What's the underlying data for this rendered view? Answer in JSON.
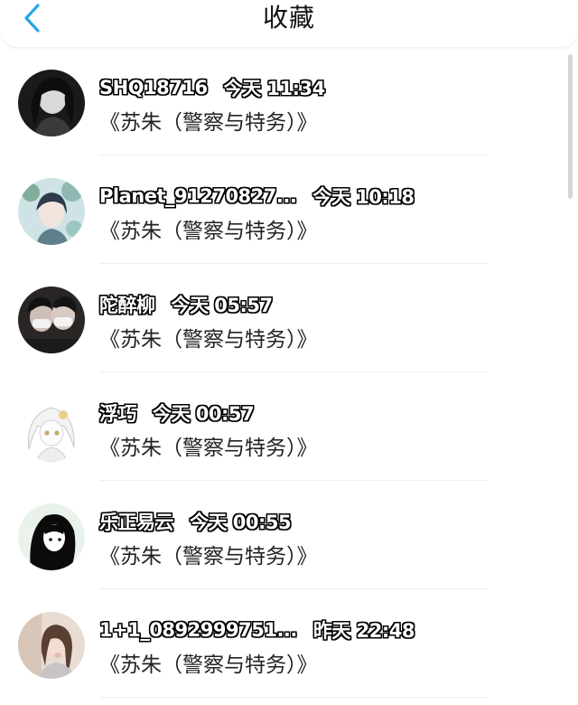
{
  "header": {
    "title": "收藏"
  },
  "favorites": [
    {
      "username": "SHQ18716",
      "time": "今天 11:34",
      "work_title": "《苏朱（警察与特务）》",
      "avatar": "avatar-dark-portrait"
    },
    {
      "username": "Planet_91270827...",
      "time": "今天 10:18",
      "work_title": "《苏朱（警察与特务）》",
      "avatar": "avatar-illustrated-portrait"
    },
    {
      "username": "陀醉柳",
      "time": "今天 05:57",
      "work_title": "《苏朱（警察与特务）》",
      "avatar": "avatar-masked-couple"
    },
    {
      "username": "浮巧",
      "time": "今天 00:57",
      "work_title": "《苏朱（警察与特务）》",
      "avatar": "avatar-anime-white-hair"
    },
    {
      "username": "乐正易云",
      "time": "今天 00:55",
      "work_title": "《苏朱（警察与特务）》",
      "avatar": "avatar-anime-black-hair"
    },
    {
      "username": "1+1_0892999751...",
      "time": "昨天 22:48",
      "work_title": "《苏朱（警察与特务）》",
      "avatar": "avatar-girl-photo"
    }
  ],
  "colors": {
    "back_icon": "#2aa5e8",
    "title_text": "#111111",
    "divider": "#efefef"
  }
}
